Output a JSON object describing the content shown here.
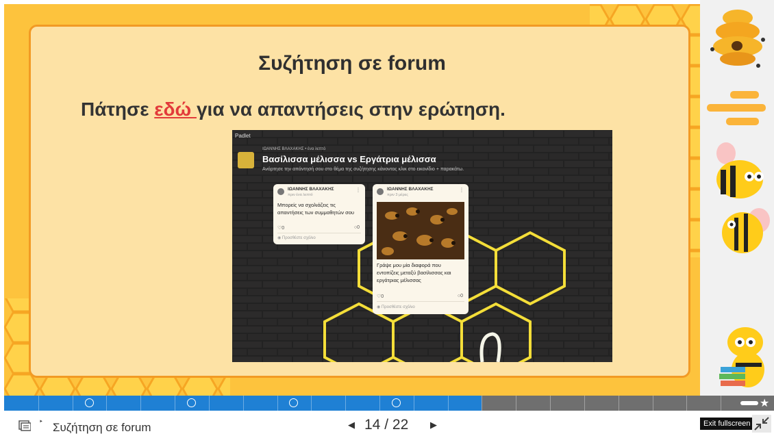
{
  "slide": {
    "title": "Συζήτηση σε forum",
    "instruction_before": "Πάτησε ",
    "instruction_link": "εδώ ",
    "instruction_after": "για να απαντήσεις στην ερώτηση."
  },
  "padlet": {
    "brand": "Padlet",
    "author_line": "ΙΩΑΝΝΗΣ ΒΛΑΧΑΚΗΣ • ένα λεπτό",
    "title": "Βασίλισσα μέλισσα vs Εργάτρια μέλισσα",
    "description": "Ανάρτησε την απάντησή σου στο θέμα της συζήτησης κάνοντας κλικ στο εικονίδιο + παρακάτω.",
    "cards": [
      {
        "author": "ΙΩΑΝΝΗΣ ΒΛΑΧΑΚΗΣ",
        "time": "πριν ένα λεπτό",
        "text": "Μπορείς να σχολιάζεις τις απαντήσεις των συμμαθητών σου",
        "likes": "0",
        "comments": "0",
        "add_comment": "Προσθέστε σχόλιο"
      },
      {
        "author": "ΙΩΑΝΝΗΣ ΒΛΑΧΑΚΗΣ",
        "time": "πριν 3 μέρες",
        "text": "Γράψε μου μία διαφορά που εντοπίζεις μεταξύ βασίλισσας και εργάτριας μέλισσας",
        "likes": "0",
        "comments": "0",
        "add_comment": "Προσθέστε σχόλιο"
      }
    ]
  },
  "footer": {
    "slide_name": "Συζήτηση σε forum",
    "current_page": "14",
    "separator": "/",
    "total_pages": "22",
    "exit_tooltip": "Exit fullscreen"
  },
  "progress": {
    "current": 14,
    "total": 22
  },
  "colors": {
    "honey": "#fdc33d",
    "panel": "#fde2a5",
    "border": "#f29a24",
    "link_red": "#e23a3a",
    "progress_blue": "#1f80d4"
  }
}
